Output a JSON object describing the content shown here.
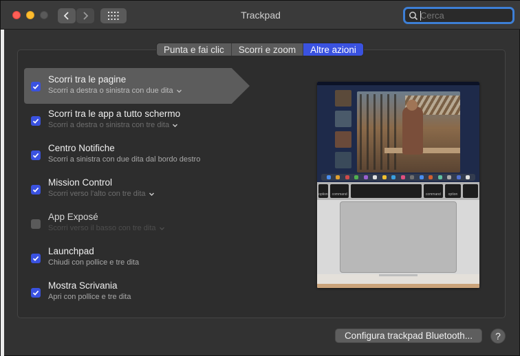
{
  "window": {
    "title": "Trackpad"
  },
  "search": {
    "placeholder": "Cerca",
    "value": ""
  },
  "tabs": [
    {
      "label": "Punta e fai clic",
      "active": false
    },
    {
      "label": "Scorri e zoom",
      "active": false
    },
    {
      "label": "Altre azioni",
      "active": true
    }
  ],
  "gestures": [
    {
      "title": "Scorri tra le pagine",
      "subtitle": "Scorri a destra o sinistra con due dita",
      "checked": true,
      "has_dropdown": true,
      "selected": true
    },
    {
      "title": "Scorri tra le app a tutto schermo",
      "subtitle": "Scorri a destra o sinistra con tre dita",
      "checked": true,
      "has_dropdown": true
    },
    {
      "title": "Centro Notifiche",
      "subtitle": "Scorri a sinistra con due dita dal bordo destro",
      "checked": true,
      "has_dropdown": false
    },
    {
      "title": "Mission Control",
      "subtitle": "Scorri verso l'alto con tre dita",
      "checked": true,
      "has_dropdown": true
    },
    {
      "title": "App Exposé",
      "subtitle": "Scorri verso il basso con tre dita",
      "checked": false,
      "has_dropdown": true
    },
    {
      "title": "Launchpad",
      "subtitle": "Chiudi con pollice e tre dita",
      "checked": true,
      "has_dropdown": false
    },
    {
      "title": "Mostra Scrivania",
      "subtitle": "Apri con pollice e tre dita",
      "checked": true,
      "has_dropdown": false
    }
  ],
  "preview": {
    "keys": [
      "option",
      "command",
      "",
      "command",
      "option"
    ]
  },
  "buttons": {
    "bluetooth": "Configura trackpad Bluetooth...",
    "help": "?"
  },
  "colors": {
    "accent": "#3a52e0",
    "window_bg": "#323232",
    "focus_ring": "#3d7fd6"
  }
}
